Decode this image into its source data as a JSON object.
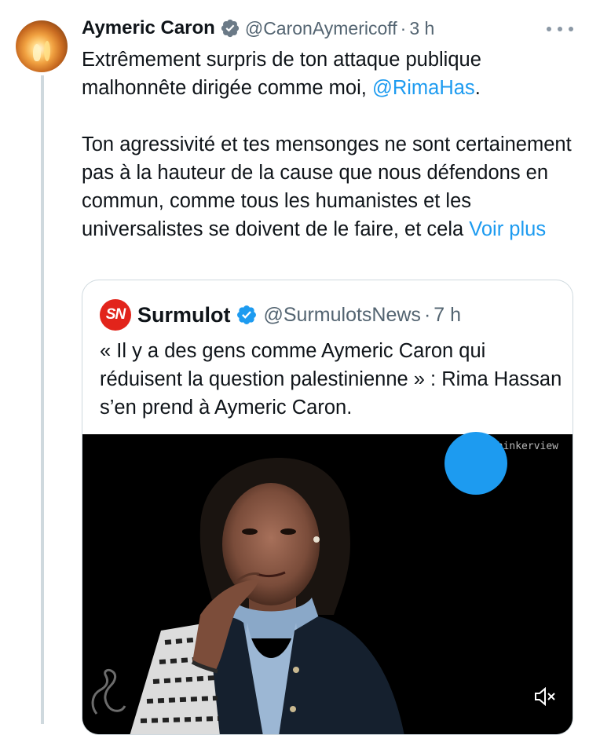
{
  "tweet": {
    "author_name": "Aymeric Caron",
    "handle": "@CaronAymericoff",
    "separator": "·",
    "time": "3 h",
    "para1_before": "Extrêmement surpris de ton attaque publique malhonnête dirigée comme moi, ",
    "para1_mention": "@RimaHas",
    "para1_after": ".",
    "para2": "Ton agressivité et tes mensonges ne sont certainement pas à la hauteur de la cause que nous défendons en commun, comme tous les humanistes et les universalistes se doivent de le faire, et cela ",
    "show_more": "Voir plus"
  },
  "quote": {
    "logo_text": "SN",
    "author_name": "Surmulot",
    "handle": "@SurmulotsNews",
    "separator": "·",
    "time": "7 h",
    "text": "« Il y a des gens comme Aymeric Caron qui réduisent la question palestinienne » : Rima Hassan s’en prend à Aymeric Caron.",
    "media": {
      "watermark": "Thinkerview",
      "icons": [
        "mute-icon",
        "swan-logo-icon"
      ]
    }
  },
  "colors": {
    "link": "#1d9bf0",
    "text": "#0f1419",
    "secondary": "#536471",
    "border": "#cfd9de",
    "sn_red": "#e2241b"
  }
}
